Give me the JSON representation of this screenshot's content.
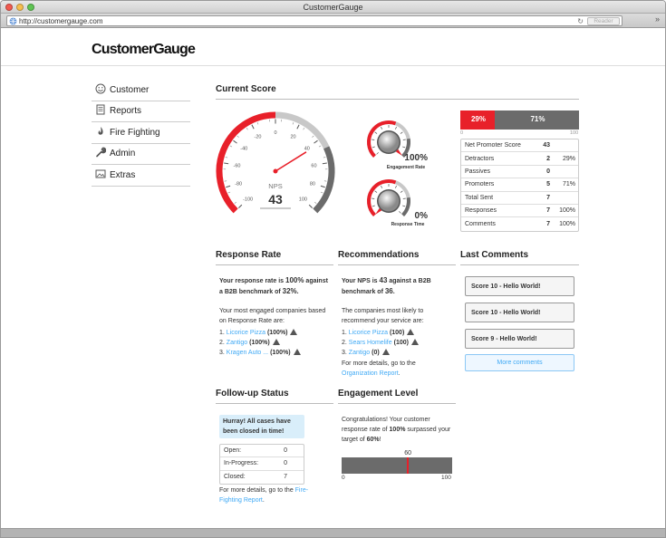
{
  "browser": {
    "window_title": "CustomerGauge",
    "url": "http://customergauge.com",
    "reader_label": "Reader"
  },
  "header": {
    "logo": "CustomerGauge"
  },
  "sidebar": {
    "items": [
      {
        "label": "Customer",
        "icon": "smiley-icon"
      },
      {
        "label": "Reports",
        "icon": "document-icon"
      },
      {
        "label": "Fire Fighting",
        "icon": "flame-icon"
      },
      {
        "label": "Admin",
        "icon": "wrench-icon"
      },
      {
        "label": "Extras",
        "icon": "image-icon"
      }
    ]
  },
  "current_score": {
    "title": "Current Score",
    "nps_gauge": {
      "label": "NPS",
      "value": "43",
      "value_number": 43,
      "range": [
        -100,
        100
      ],
      "ticks": [
        "-100",
        "-80",
        "-60",
        "-40",
        "-20",
        "0",
        "20",
        "40",
        "60",
        "80",
        "100"
      ]
    },
    "engagement_gauge": {
      "label": "Engagement Rate",
      "value": "100%",
      "fraction": 1.0
    },
    "response_gauge": {
      "label": "Response Time",
      "value": "0%",
      "fraction": 0.0
    },
    "bar": {
      "detractor_pct": "29%",
      "promoter_pct": "71%",
      "detractor_fraction": 0.29,
      "axis_min": "0",
      "axis_max": "100",
      "colors": {
        "detractor": "#e8202a",
        "promoter": "#6b6b6b"
      }
    },
    "table": [
      {
        "label": "Net Promoter Score",
        "count": "43",
        "pct": ""
      },
      {
        "label": "Detractors",
        "count": "2",
        "pct": "29%"
      },
      {
        "label": "Passives",
        "count": "0",
        "pct": ""
      },
      {
        "label": "Promoters",
        "count": "5",
        "pct": "71%"
      },
      {
        "label": "Total Sent",
        "count": "7",
        "pct": ""
      },
      {
        "label": "Responses",
        "count": "7",
        "pct": "100%"
      },
      {
        "label": "Comments",
        "count": "7",
        "pct": "100%"
      }
    ]
  },
  "response_rate": {
    "title": "Response Rate",
    "summary_pre": "Your response rate is ",
    "summary_value": "100%",
    "summary_mid": " against a B2B benchmark of ",
    "summary_bench": "32%",
    "summary_end": ".",
    "intro": "Your most engaged companies based on Response Rate are:",
    "companies": [
      {
        "num": "1. ",
        "name": "Licorice Pizza",
        "value": "(100%)"
      },
      {
        "num": "2. ",
        "name": "Zantigo",
        "value": "(100%)"
      },
      {
        "num": "3. ",
        "name": "Kragen Auto ...",
        "value": "(100%)"
      }
    ]
  },
  "recommendations": {
    "title": "Recommendations",
    "summary_pre": "Your NPS is ",
    "summary_value": "43",
    "summary_mid": " against a B2B benchmark of ",
    "summary_bench": "36",
    "summary_end": ".",
    "intro": "The companies most likely to recommend your service are:",
    "companies": [
      {
        "num": "1. ",
        "name": "Licorice Pizza",
        "value": "(100)"
      },
      {
        "num": "2. ",
        "name": "Sears Homelife",
        "value": "(100)"
      },
      {
        "num": "3. ",
        "name": "Zantigo",
        "value": "(0)"
      }
    ],
    "details_pre": "For more details, go to the ",
    "details_link": "Organization Report",
    "details_end": "."
  },
  "last_comments": {
    "title": "Last Comments",
    "items": [
      "Score 10 - Hello World!",
      "Score 10 - Hello World!",
      "Score 9 - Hello World!"
    ],
    "more_label": "More comments"
  },
  "followup": {
    "title": "Follow-up Status",
    "alert": "Hurray! All cases have been closed in time!",
    "rows": [
      {
        "label": "Open:",
        "value": "0"
      },
      {
        "label": "In-Progress:",
        "value": "0"
      },
      {
        "label": "Closed:",
        "value": "7"
      }
    ],
    "details_pre": "For more details, go to the ",
    "details_link": "Fire-Fighting Report",
    "details_end": "."
  },
  "engagement": {
    "title": "Engagement Level",
    "text_pre": "Congratulations! Your customer response rate of ",
    "text_value": "100%",
    "text_mid": " surpassed your target of ",
    "text_target": "60%",
    "text_end": "!",
    "target_label": "60",
    "target_fraction": 0.6,
    "axis_min": "0",
    "axis_max": "100"
  }
}
